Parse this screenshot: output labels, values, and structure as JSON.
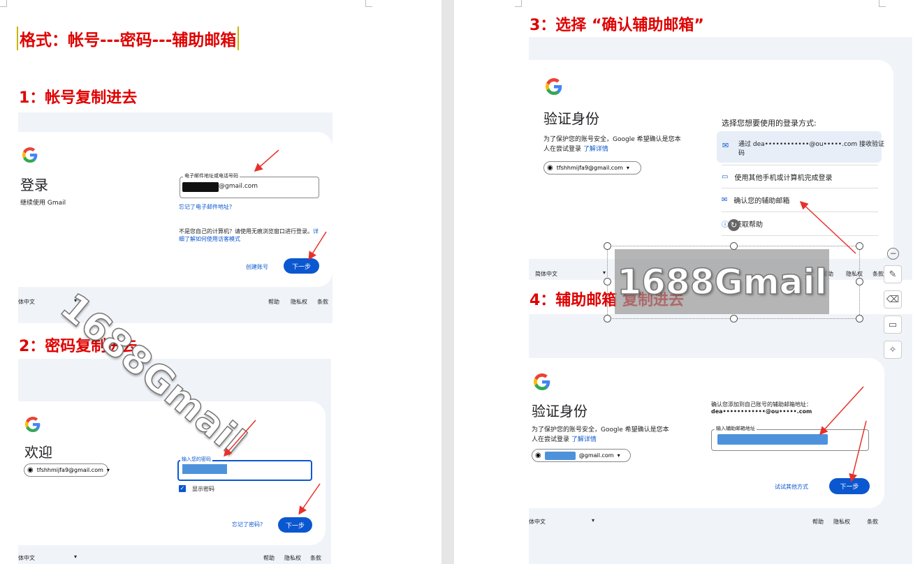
{
  "headings": {
    "format": "格式：帐号---密码---辅助邮箱",
    "step1": "1：帐号复制进去",
    "step2": "2：密码复制进去",
    "step3": "3：选择 “确认辅助邮箱”",
    "step4": "4：辅助邮箱 复制进去"
  },
  "watermark": "1688Gmail",
  "login": {
    "title": "登录",
    "subtitle": "继续使用 Gmail",
    "field_label": "电子邮件地址或电话号码",
    "field_value": "@gmail.com",
    "forgot": "忘记了电子邮件地址?",
    "notice": "不是您自己的计算机？请使用无痕浏览窗口进行登录。",
    "notice_link1": "详",
    "notice_link2": "细了解如何使用访客模式",
    "create": "创建账号",
    "next": "下一步",
    "lang": "体中文",
    "help": "帮助",
    "privacy": "隐私权",
    "terms": "条款"
  },
  "welcome": {
    "title": "欢迎",
    "account": "tfshhmijfa9@gmail.com",
    "field_label": "输入您的密码",
    "show_password": "显示密码",
    "forgot": "忘记了密码?",
    "next": "下一步",
    "lang": "体中文",
    "help": "帮助",
    "privacy": "隐私权",
    "terms": "条款"
  },
  "verify1": {
    "title": "验证身份",
    "desc1": "为了保护您的账号安全，Google 希望确认是您本",
    "desc2": "人在尝试登录",
    "learn": "了解详情",
    "account": "tfshhmijfa9@gmail.com",
    "choose": "选择您想要使用的登录方式:",
    "opt1a": "通过 dea••••••••••••@ou•••••.com 接收验证",
    "opt1b": "码",
    "opt2": "使用其他手机或计算机完成登录",
    "opt3": "确认您的辅助邮箱",
    "opt4": "获取帮助",
    "lang": "简体中文",
    "help": "帮助",
    "privacy": "隐私权",
    "terms": "条款"
  },
  "verify2": {
    "title": "验证身份",
    "desc1": "为了保护您的账号安全，Google 希望确认是您本",
    "desc2": "人在尝试登录",
    "learn": "了解详情",
    "account": "@gmail.com",
    "confirm1": "确认您添加到自己账号的辅助邮箱地址：",
    "confirm2": "dea••••••••••••@ou•••••.com",
    "field_label": "输入辅助邮箱地址",
    "try_other": "试试其他方式",
    "next": "下一步",
    "lang": "体中文",
    "help": "帮助",
    "privacy": "隐私权",
    "terms": "条款"
  },
  "icons": [
    "google-logo-icon",
    "account-circle-icon",
    "chevron-down-icon",
    "mail-icon",
    "devices-icon",
    "help-icon",
    "checkbox-icon",
    "minus-icon",
    "pen-icon",
    "eraser-icon",
    "monitor-icon",
    "magic-icon",
    "rotate-icon"
  ],
  "colors": {
    "heading_red": "#e00000",
    "google_blue": "#0b57d0",
    "panel_bg": "#f0f4f9",
    "mask_blue": "#2f7fd6",
    "arrow_red": "#e8302a"
  }
}
